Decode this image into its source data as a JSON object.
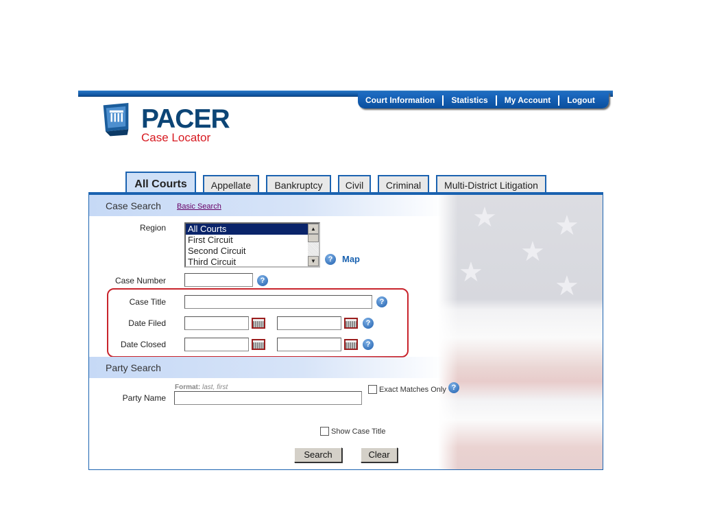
{
  "nav": {
    "items": [
      "Court Information",
      "Statistics",
      "My Account",
      "Logout"
    ]
  },
  "logo": {
    "title": "PACER",
    "subtitle": "Case Locator"
  },
  "tabs": [
    "All Courts",
    "Appellate",
    "Bankruptcy",
    "Civil",
    "Criminal",
    "Multi-District Litigation"
  ],
  "active_tab": "All Courts",
  "case_search": {
    "heading": "Case Search",
    "basic_search_link": "Basic Search",
    "region_label": "Region",
    "region_options": [
      "All Courts",
      "First Circuit",
      "Second Circuit",
      "Third Circuit"
    ],
    "region_selected": "All Courts",
    "map_link": "Map",
    "case_number_label": "Case Number",
    "case_number_value": "",
    "case_title_label": "Case Title",
    "case_title_value": "",
    "date_filed_label": "Date Filed",
    "date_filed_from": "",
    "date_filed_to": "",
    "date_closed_label": "Date Closed",
    "date_closed_from": "",
    "date_closed_to": ""
  },
  "party_search": {
    "heading": "Party Search",
    "format_label": "Format:",
    "format_hint": "last, first",
    "party_name_label": "Party Name",
    "party_name_value": "",
    "exact_matches_label": "Exact Matches Only",
    "exact_matches_checked": false
  },
  "show_case_title_label": "Show Case Title",
  "show_case_title_checked": false,
  "buttons": {
    "search": "Search",
    "clear": "Clear"
  },
  "help_glyph": "?",
  "colors": {
    "brand_blue": "#1a62b0",
    "logo_navy": "#0c4576",
    "logo_red": "#d71920",
    "highlight_border": "#c8232b"
  }
}
